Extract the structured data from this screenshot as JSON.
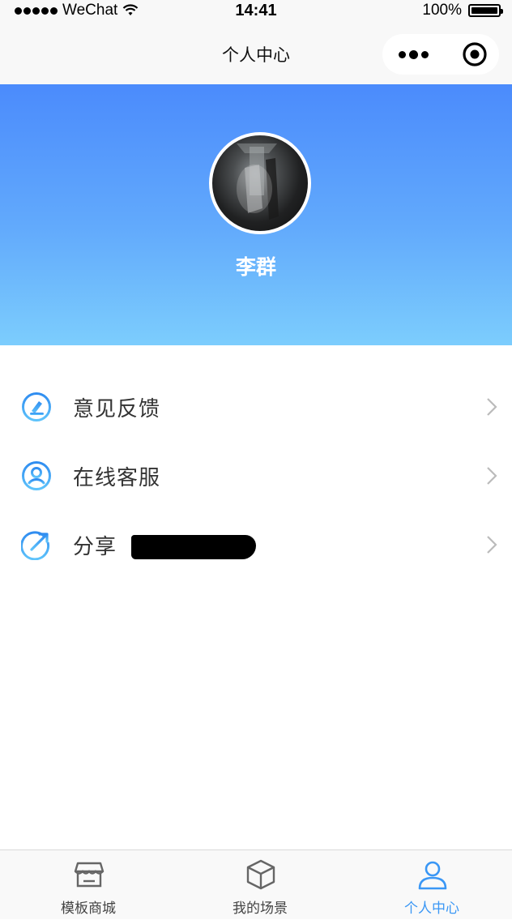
{
  "status_bar": {
    "carrier": "WeChat",
    "time": "14:41",
    "battery": "100%"
  },
  "nav": {
    "title": "个人中心"
  },
  "profile": {
    "name": "李群"
  },
  "menu": {
    "items": [
      {
        "label": "意见反馈",
        "icon": "edit-icon"
      },
      {
        "label": "在线客服",
        "icon": "user-service-icon"
      },
      {
        "label": "分享",
        "icon": "share-icon"
      }
    ]
  },
  "tabs": {
    "items": [
      {
        "label": "模板商城",
        "icon": "shop-icon",
        "active": false
      },
      {
        "label": "我的场景",
        "icon": "box-icon",
        "active": false
      },
      {
        "label": "个人中心",
        "icon": "person-icon",
        "active": true
      }
    ]
  },
  "colors": {
    "accent": "#3a97f5",
    "hero_top": "#4b8bfc",
    "hero_bottom": "#7ccdfd"
  }
}
